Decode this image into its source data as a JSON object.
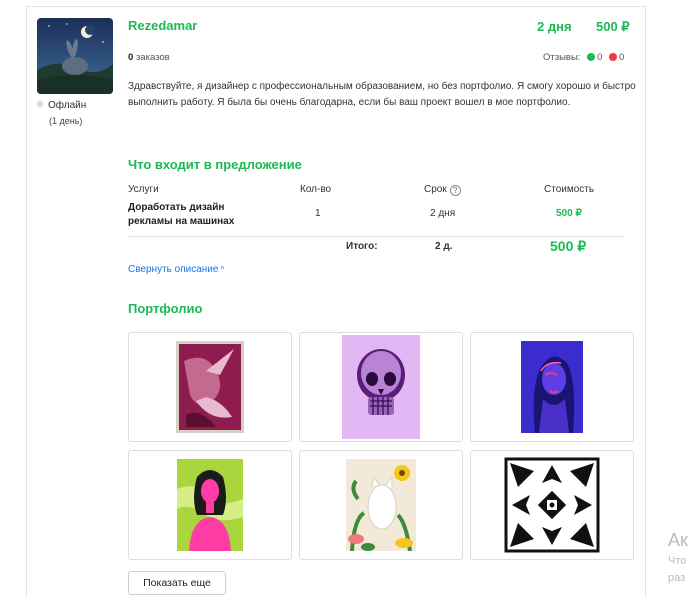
{
  "seller": {
    "name": "Rezedamar",
    "status": "Офлайн",
    "status_since": "(1 день)",
    "orders_count": "0",
    "orders_label": "заказов",
    "reviews_label": "Отзывы:",
    "reviews_positive": "0",
    "reviews_negative": "0"
  },
  "offer": {
    "days": "2 дня",
    "price": "500 ₽",
    "description": "Здравствуйте, я дизайнер с профессиональным образованием, но без портфолио. Я смогу хорошо и быстро выполнить работу. Я была бы очень благодарна, если бы ваш проект вошел в мое портфолио."
  },
  "includes": {
    "title": "Что входит в предложение",
    "headers": {
      "service": "Услуги",
      "qty": "Кол-во",
      "term": "Срок",
      "cost": "Стоимость"
    },
    "rows": [
      {
        "service": "Доработать дизайн рекламы на машинах",
        "qty": "1",
        "term": "2 дня",
        "cost": "500 ₽"
      }
    ],
    "total_label": "Итого:",
    "total_term": "2 д.",
    "total_cost": "500 ₽"
  },
  "collapse_label": "Свернуть описание",
  "portfolio": {
    "title": "Портфолио",
    "items": [
      "hummingbird-art",
      "purple-skull-art",
      "neon-portrait-art",
      "pink-woman-art",
      "white-cat-flowers-art",
      "black-white-ornament-art"
    ],
    "show_more_label": "Показать еще"
  },
  "side_fragment": {
    "line1": "Ак",
    "line2": "Что",
    "line3": "раз"
  },
  "colors": {
    "accent": "#1db954",
    "link": "#1a73e8",
    "negative": "#ef3b3b"
  }
}
